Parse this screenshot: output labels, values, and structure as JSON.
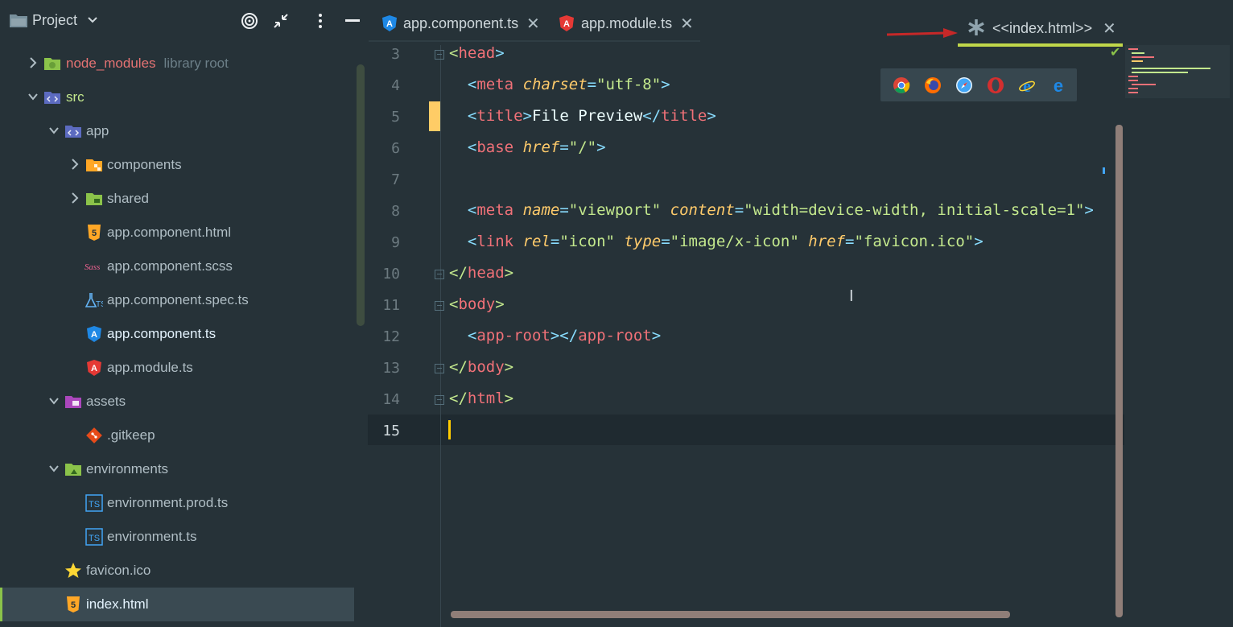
{
  "panel": {
    "title": "Project",
    "chevron": "chevron-down-icon"
  },
  "tree": [
    {
      "label": "node_modules",
      "sub": "library root",
      "icon": "folder-green-icon",
      "expanded": false
    },
    {
      "label": "src",
      "icon": "src-folder-icon",
      "expanded": true
    },
    {
      "label": "app",
      "icon": "app-folder-icon",
      "expanded": true
    },
    {
      "label": "components",
      "icon": "components-folder-icon",
      "expanded": false
    },
    {
      "label": "shared",
      "icon": "shared-folder-icon",
      "expanded": false
    },
    {
      "label": "app.component.html",
      "icon": "html5-icon"
    },
    {
      "label": "app.component.scss",
      "icon": "sass-icon"
    },
    {
      "label": "app.component.spec.ts",
      "icon": "test-flask-icon"
    },
    {
      "label": "app.component.ts",
      "icon": "angular-blue-icon"
    },
    {
      "label": "app.module.ts",
      "icon": "angular-red-icon"
    },
    {
      "label": "assets",
      "icon": "assets-folder-icon",
      "expanded": true
    },
    {
      "label": ".gitkeep",
      "icon": "git-icon"
    },
    {
      "label": "environments",
      "icon": "environments-folder-icon",
      "expanded": true
    },
    {
      "label": "environment.prod.ts",
      "icon": "typescript-icon"
    },
    {
      "label": "environment.ts",
      "icon": "typescript-icon"
    },
    {
      "label": "favicon.ico",
      "icon": "star-icon"
    },
    {
      "label": "index.html",
      "icon": "html5-icon",
      "selected": true
    }
  ],
  "tabs": [
    {
      "label": "app.component.ts",
      "icon": "angular-blue-icon"
    },
    {
      "label": "app.module.ts",
      "icon": "angular-red-icon"
    },
    {
      "label": "<<index.html>>",
      "icon": "asterisk-icon",
      "active": true
    }
  ],
  "editor": {
    "line_numbers": [
      "3",
      "4",
      "5",
      "6",
      "7",
      "8",
      "9",
      "10",
      "11",
      "12",
      "13",
      "14",
      "15"
    ]
  },
  "browsers": [
    "chrome-icon",
    "firefox-icon",
    "safari-icon",
    "opera-icon",
    "ie-icon",
    "edge-icon"
  ],
  "colors": {
    "background": "#263238",
    "tag": "#f07178",
    "attribute": "#ffcb6b",
    "string": "#c3e88d",
    "bracket": "#89ddff",
    "accent": "#c0d74a"
  }
}
